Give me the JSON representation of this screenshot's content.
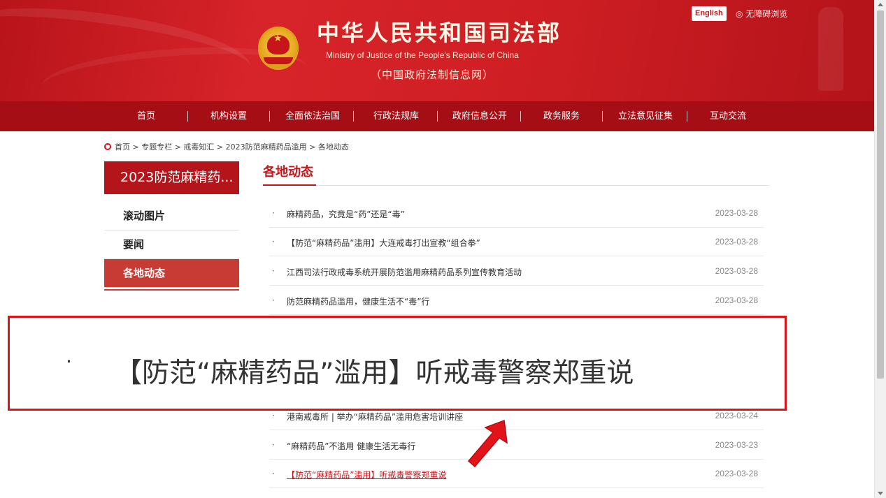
{
  "header": {
    "title": "中华人民共和国司法部",
    "subtitle_en": "Ministry of Justice of the People's Republic of China",
    "subtitle_cn": "（中国政府法制信息网）",
    "english_label": "English",
    "accessibility_label": "◎ 无障碍浏览"
  },
  "nav": {
    "items": [
      "首页",
      "机构设置",
      "全面依法治国",
      "行政法规库",
      "政府信息公开",
      "政务服务",
      "立法意见征集",
      "互动交流"
    ]
  },
  "breadcrumb": "首页 > 专题专栏 > 戒毒知汇 > 2023防范麻精药品滥用 > 各地动态",
  "sidebar": {
    "heading": "2023防范麻精药...",
    "items": [
      {
        "label": "滚动图片"
      },
      {
        "label": "要闻"
      },
      {
        "label": "各地动态"
      }
    ]
  },
  "main": {
    "section_title": "各地动态",
    "news": [
      {
        "bullet": "·",
        "title": "麻精药品，究竟是“药”还是“毒”",
        "date": "2023-03-28"
      },
      {
        "bullet": "·",
        "title": "【防范“麻精药品”滥用】大连戒毒打出宣教“组合拳”",
        "date": "2023-03-28"
      },
      {
        "bullet": "·",
        "title": "江西司法行政戒毒系统开展防范滥用麻精药品系列宣传教育活动",
        "date": "2023-03-28"
      },
      {
        "bullet": "·",
        "title": "防范麻精药品滥用，健康生活不“毒”行",
        "date": "2023-03-28"
      },
      {
        "bullet": "·",
        "title": "港南戒毒所 | 举办“麻精药品”滥用危害培训讲座",
        "date": "2023-03-24"
      },
      {
        "bullet": "·",
        "title": "“麻精药品”不滥用 健康生活无毒行",
        "date": "2023-03-23"
      },
      {
        "bullet": "·",
        "title": "【防范“麻精药品”滥用】听戒毒警察郑重说",
        "date": "2023-03-28"
      }
    ]
  },
  "zoom": {
    "bullet": "·",
    "text": "【防范“麻精药品”滥用】听戒毒警察郑重说"
  },
  "colors": {
    "brand_red": "#c6161c",
    "nav_red": "#a50e14",
    "highlight_border": "#d9151b"
  },
  "icons": {
    "emblem": "national-emblem",
    "pointer": "red-arrow",
    "breadcrumb_marker": "circle-bullet"
  }
}
